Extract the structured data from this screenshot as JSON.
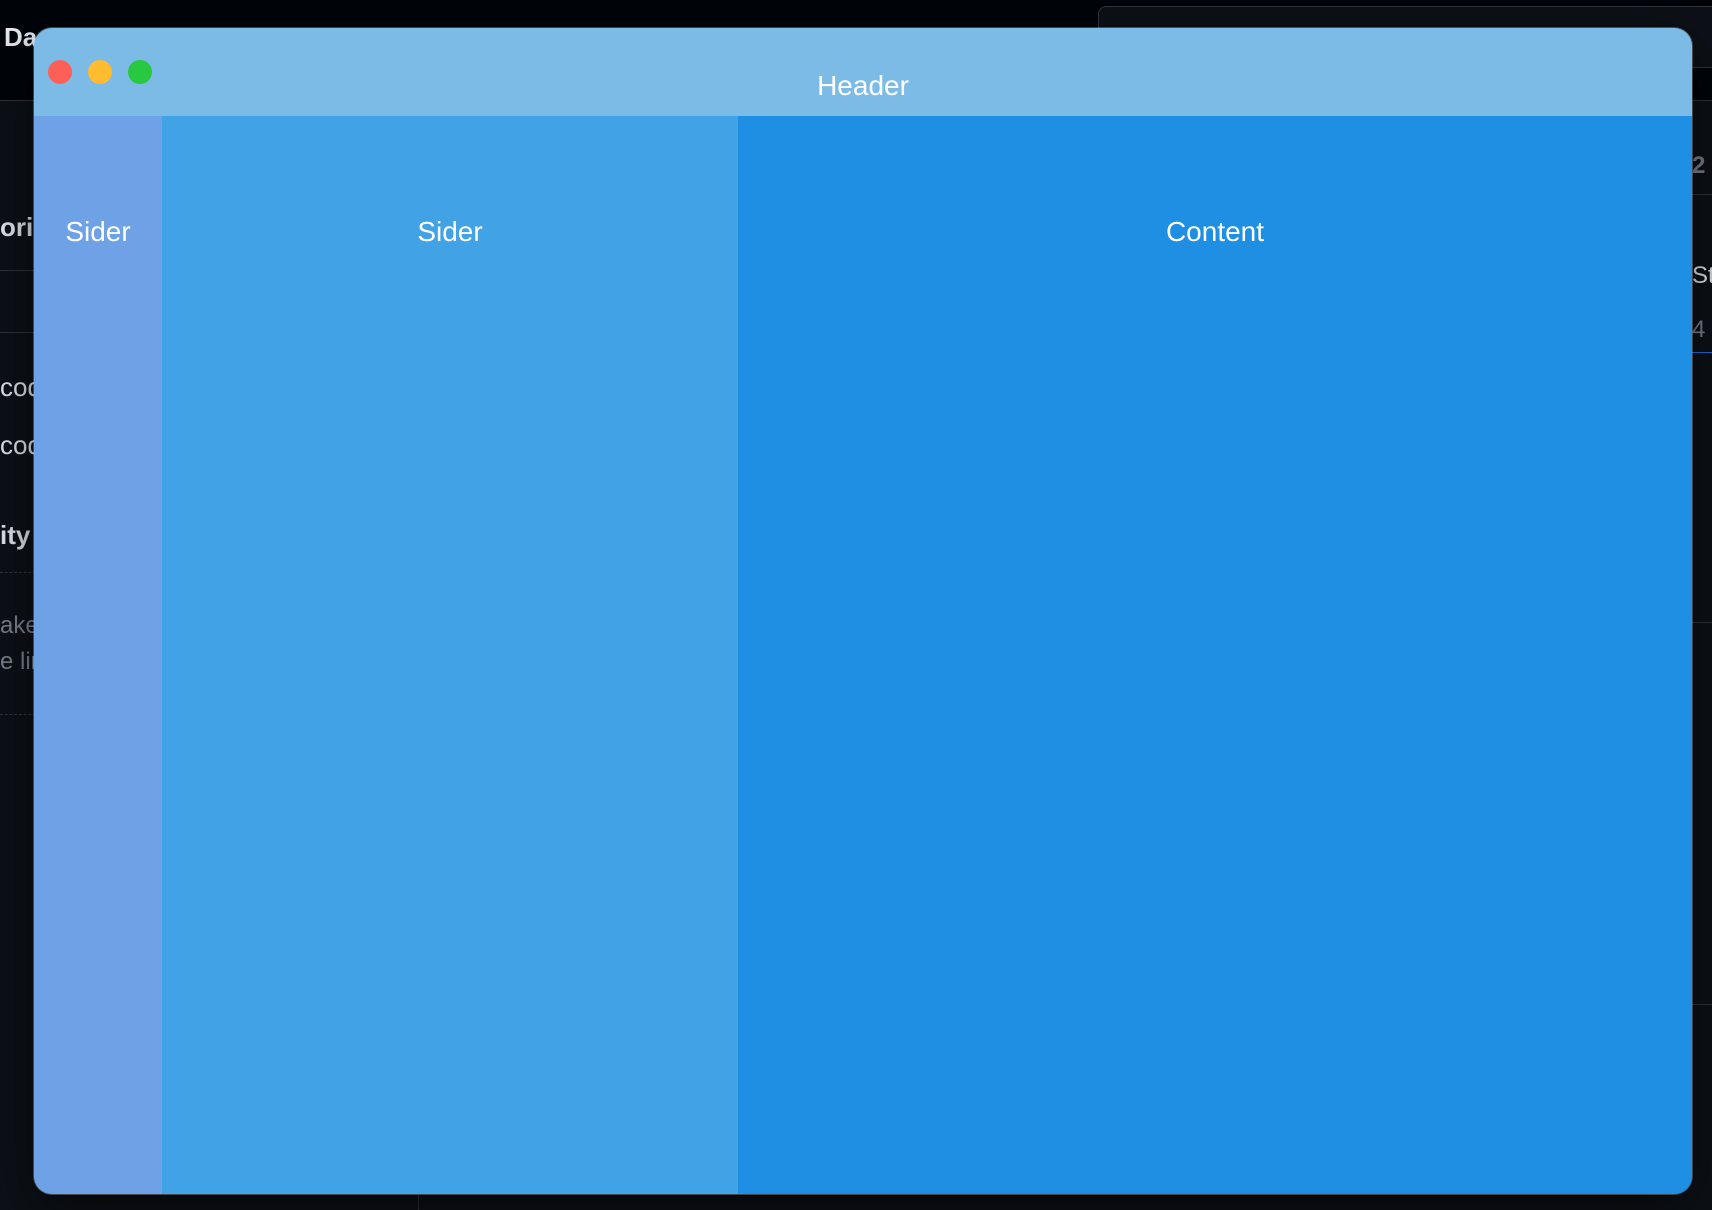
{
  "background_app": {
    "title_fragment": "Da",
    "left_fragments": [
      "orie",
      "cod",
      "cod",
      "ity",
      "ake",
      "e lin"
    ],
    "right_fragments": [
      "2",
      "St",
      "4"
    ]
  },
  "window": {
    "header": {
      "title": "Header"
    },
    "sider_narrow": {
      "label": "Sider"
    },
    "sider_wide": {
      "label": "Sider"
    },
    "content": {
      "label": "Content"
    },
    "colors": {
      "header": "#7dbbe7",
      "sider_narrow": "#6ea1e6",
      "sider_wide": "#41a2e6",
      "content": "#1f8fe4",
      "close": "#fe5f57",
      "minimize": "#febc2e",
      "maximize": "#28c840"
    }
  }
}
